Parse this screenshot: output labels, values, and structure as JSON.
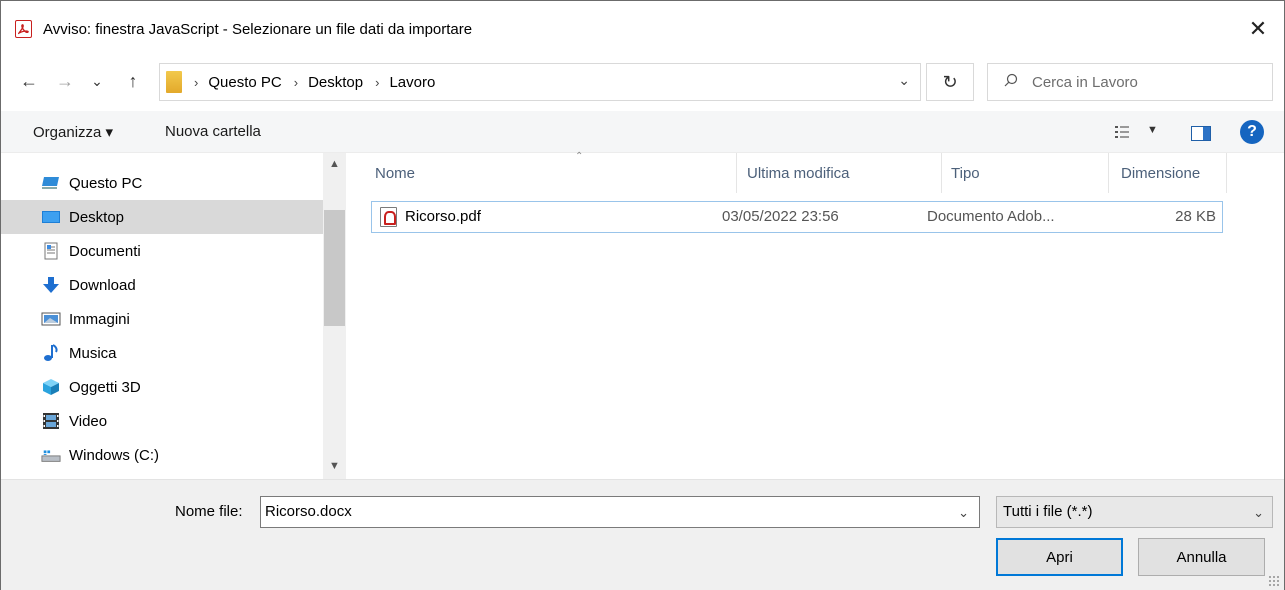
{
  "window": {
    "title": "Avviso: finestra JavaScript - Selezionare un file dati da importare",
    "close_glyph": "✕"
  },
  "nav": {
    "back_glyph": "←",
    "forward_glyph": "→",
    "recent_glyph": "⌄",
    "up_glyph": "↑",
    "breadcrumbs": [
      "Questo PC",
      "Desktop",
      "Lavoro"
    ],
    "separator": "›",
    "refresh_glyph": "↻",
    "search_placeholder": "Cerca in Lavoro"
  },
  "toolbar": {
    "organize_label": "Organizza ▾",
    "new_folder_label": "Nuova cartella",
    "help_glyph": "?"
  },
  "sidebar": {
    "items": [
      {
        "label": "Questo PC",
        "icon": "computer-icon"
      },
      {
        "label": "Desktop",
        "icon": "desktop-icon",
        "selected": true
      },
      {
        "label": "Documenti",
        "icon": "documents-icon"
      },
      {
        "label": "Download",
        "icon": "download-icon"
      },
      {
        "label": "Immagini",
        "icon": "pictures-icon"
      },
      {
        "label": "Musica",
        "icon": "music-icon"
      },
      {
        "label": "Oggetti 3D",
        "icon": "objects-3d-icon"
      },
      {
        "label": "Video",
        "icon": "video-icon"
      },
      {
        "label": "Windows (C:)",
        "icon": "drive-icon"
      }
    ]
  },
  "filelist": {
    "columns": [
      "Nome",
      "Ultima modifica",
      "Tipo",
      "Dimensione"
    ],
    "rows": [
      {
        "name": "Ricorso.pdf",
        "modified": "03/05/2022 23:56",
        "type": "Documento Adob...",
        "size": "28 KB"
      }
    ]
  },
  "bottom": {
    "filename_label": "Nome file:",
    "filename_value": "Ricorso.docx",
    "filetype_value": "Tutti i file (*.*)",
    "open_label": "Apri",
    "cancel_label": "Annulla"
  },
  "colors": {
    "accent": "#0078d7",
    "selection": "#d9d9d9",
    "pdf_red": "#c8201e"
  }
}
